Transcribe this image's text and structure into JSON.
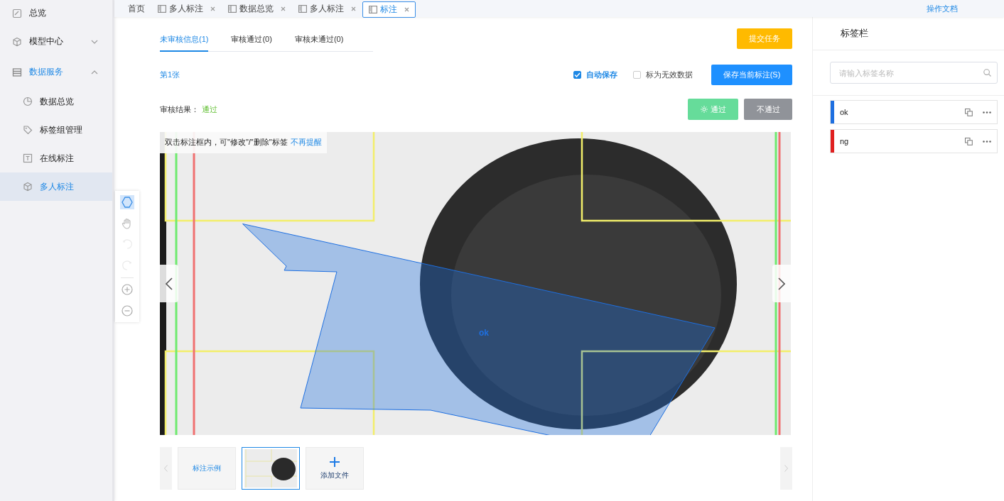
{
  "sidebar": {
    "items": [
      {
        "label": "总览",
        "selected": false
      },
      {
        "label": "模型中心",
        "selected": false,
        "expanded": false
      },
      {
        "label": "数据服务",
        "selected": true,
        "expanded": true,
        "children": [
          {
            "label": "数据总览",
            "selected": false
          },
          {
            "label": "标签组管理",
            "selected": false
          },
          {
            "label": "在线标注",
            "selected": false
          },
          {
            "label": "多人标注",
            "selected": true
          }
        ]
      }
    ]
  },
  "tabs": [
    {
      "label": "首页",
      "closable": false,
      "selected": false
    },
    {
      "label": "多人标注",
      "closable": true,
      "selected": false
    },
    {
      "label": "数据总览",
      "closable": true,
      "selected": false
    },
    {
      "label": "多人标注",
      "closable": true,
      "selected": false
    },
    {
      "label": "标注",
      "closable": true,
      "selected": true
    }
  ],
  "docs_link": "操作文档",
  "review_tabs": [
    {
      "label": "未审核信息(1)",
      "selected": true
    },
    {
      "label": "审核通过(0)",
      "selected": false
    },
    {
      "label": "审核未通过(0)",
      "selected": false
    }
  ],
  "submit_button": "提交任务",
  "image_index": "第1张",
  "options": [
    {
      "label": "自动保存",
      "checked": true
    },
    {
      "label": "标为无效数据",
      "checked": false
    }
  ],
  "save_button": "保存当前标注(S)",
  "review_result": {
    "label": "审核结果：",
    "value": "通过"
  },
  "review_buttons": [
    {
      "label": "通过",
      "kind": "pass"
    },
    {
      "label": "不通过",
      "kind": "reject"
    }
  ],
  "tools": [
    {
      "selected": true,
      "disabled": false
    },
    {
      "selected": false,
      "disabled": false
    },
    {
      "selected": false,
      "disabled": true
    },
    {
      "selected": false,
      "disabled": true
    },
    {
      "selected": false,
      "disabled": false
    },
    {
      "selected": false,
      "disabled": false
    }
  ],
  "canvas": {
    "hint": "双击标注框内，可\"修改\"/\"删除\"标签",
    "hint_link": "不再提醒",
    "annotation": {
      "label": "ok",
      "color": "#1e6fe0"
    }
  },
  "filmstrip": [
    {
      "kind": "example",
      "label": "标注示例",
      "selected": false
    },
    {
      "kind": "image",
      "selected": true
    },
    {
      "kind": "add",
      "label": "添加文件",
      "selected": false
    }
  ],
  "label_panel": {
    "title": "标签栏",
    "search_placeholder": "请输入标签名称",
    "labels": [
      {
        "name": "ok",
        "color": "#1e6fe0"
      },
      {
        "name": "ng",
        "color": "#e02020"
      }
    ]
  }
}
